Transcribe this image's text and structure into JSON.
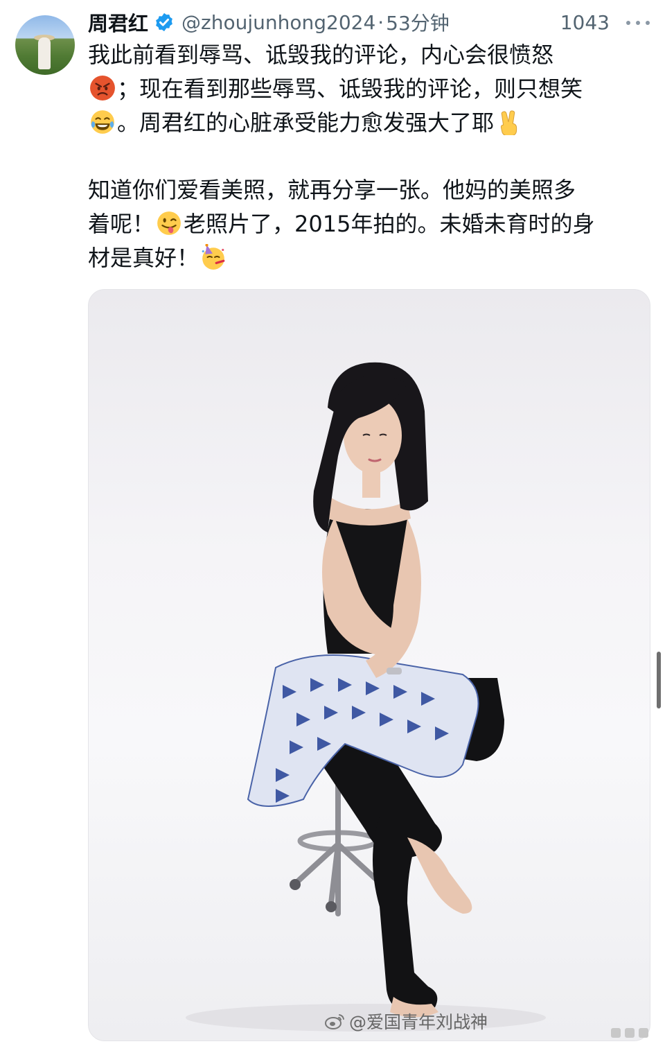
{
  "author": {
    "name": "周君红",
    "handle": "@zhoujunhong2024",
    "separator": "·",
    "time": "53分钟",
    "verified": true
  },
  "stats": {
    "views": "1043"
  },
  "post": {
    "paragraph1": {
      "line1": "我此前看到辱骂、诋毁我的评论，内心会很愤怒",
      "line2": "；现在看到那些辱骂、诋毁我的评论，则只想笑",
      "line3": "。周君红的心脏承受能力愈发强大了耶"
    },
    "paragraph2": {
      "line1": "知道你们爱看美照，就再分享一张。他妈的美照多",
      "line2a": "着呢！",
      "line2b": "老照片了，2015年拍的。未婚未育时的身",
      "line3": "材是真好！"
    }
  },
  "emojis": {
    "angry": "angry-face-icon",
    "laugh": "tears-of-joy-icon",
    "victory": "victory-hand-icon",
    "wink": "winking-tongue-icon",
    "party": "partying-face-icon"
  },
  "media": {
    "watermark": "@爱国青年刘战神"
  },
  "colors": {
    "text": "#0f1419",
    "muted": "#536471",
    "verified": "#1d9bf0"
  }
}
